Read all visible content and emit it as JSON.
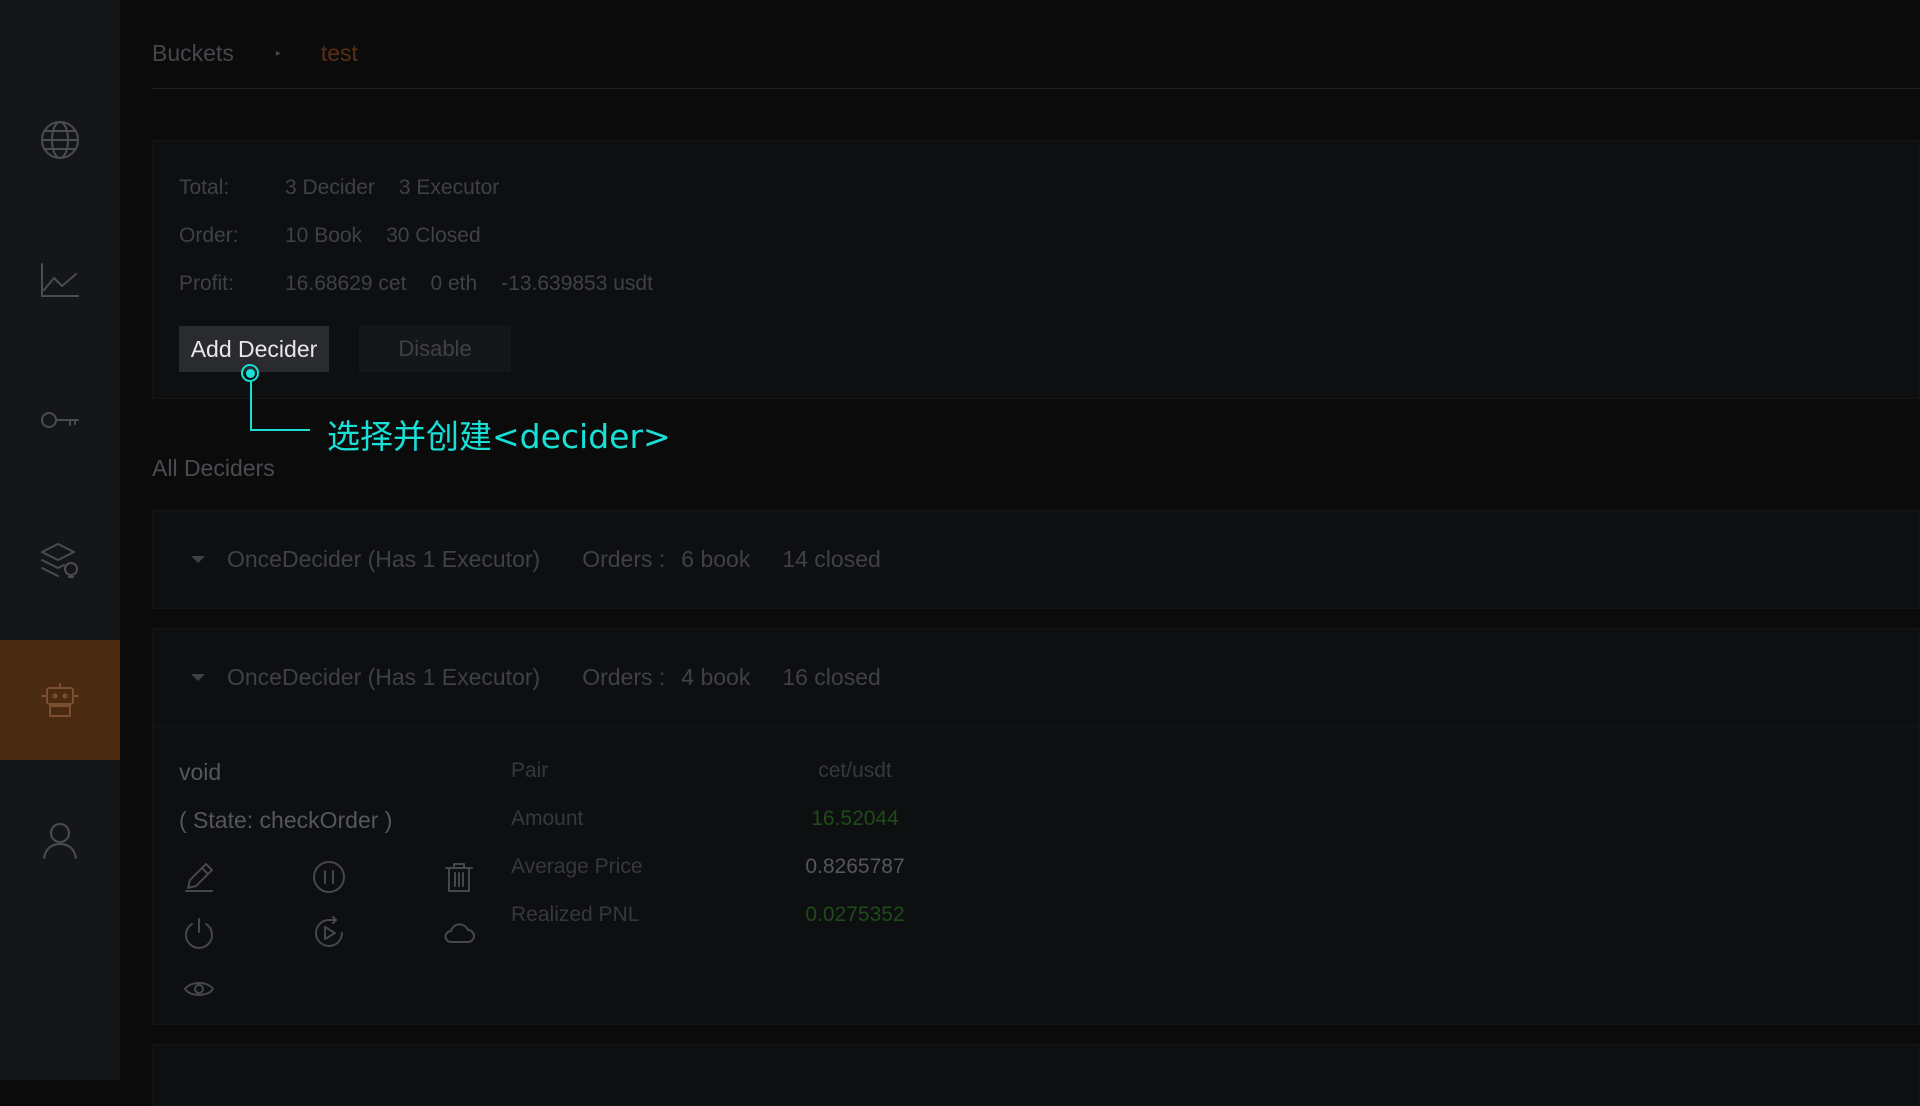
{
  "sidebar": {
    "items": [
      {
        "icon": "globe-icon",
        "name": "sidebar-item-markets"
      },
      {
        "icon": "chart-line-icon",
        "name": "sidebar-item-charts"
      },
      {
        "icon": "key-icon",
        "name": "sidebar-item-keys"
      },
      {
        "icon": "layers-bulb-icon",
        "name": "sidebar-item-strategies"
      },
      {
        "icon": "robot-icon",
        "name": "sidebar-item-bots",
        "active": true
      },
      {
        "icon": "user-icon",
        "name": "sidebar-item-account"
      }
    ],
    "active_color": "#4a2a10"
  },
  "breadcrumb": {
    "root": "Buckets",
    "separator": "▸",
    "current": "test"
  },
  "summary": {
    "total_label": "Total:",
    "total_deciders": "3 Decider",
    "total_executors": "3 Executor",
    "order_label": "Order:",
    "order_book": "10 Book",
    "order_closed": "30 Closed",
    "profit_label": "Profit:",
    "profit_cet": "16.68629 cet",
    "profit_eth": "0 eth",
    "profit_usdt": "-13.639853 usdt",
    "add_decider_label": "Add Decider",
    "disable_label": "Disable"
  },
  "tooltip": {
    "text": "选择并创建<decider>",
    "color": "#18e0d6"
  },
  "all_deciders_title": "All Deciders",
  "deciders": [
    {
      "name": "OnceDecider (Has 1 Executor)",
      "orders_label": "Orders :",
      "book": "6 book",
      "closed": "14 closed"
    },
    {
      "name": "OnceDecider (Has 1 Executor)",
      "orders_label": "Orders :",
      "book": "4 book",
      "closed": "16 closed",
      "executor": {
        "name": "void",
        "state": "( State: checkOrder )",
        "pair_label": "Pair",
        "pair_value": "cet/usdt",
        "amount_label": "Amount",
        "amount_value": "16.52044",
        "avg_price_label": "Average Price",
        "avg_price_value": "0.8265787",
        "pnl_label": "Realized PNL",
        "pnl_value": "0.0275352",
        "positive_color": "#1f4a1a",
        "actions": [
          "edit-icon",
          "pause-icon",
          "trash-icon",
          "power-icon",
          "replay-icon",
          "cloud-icon",
          "eye-icon"
        ]
      }
    }
  ]
}
